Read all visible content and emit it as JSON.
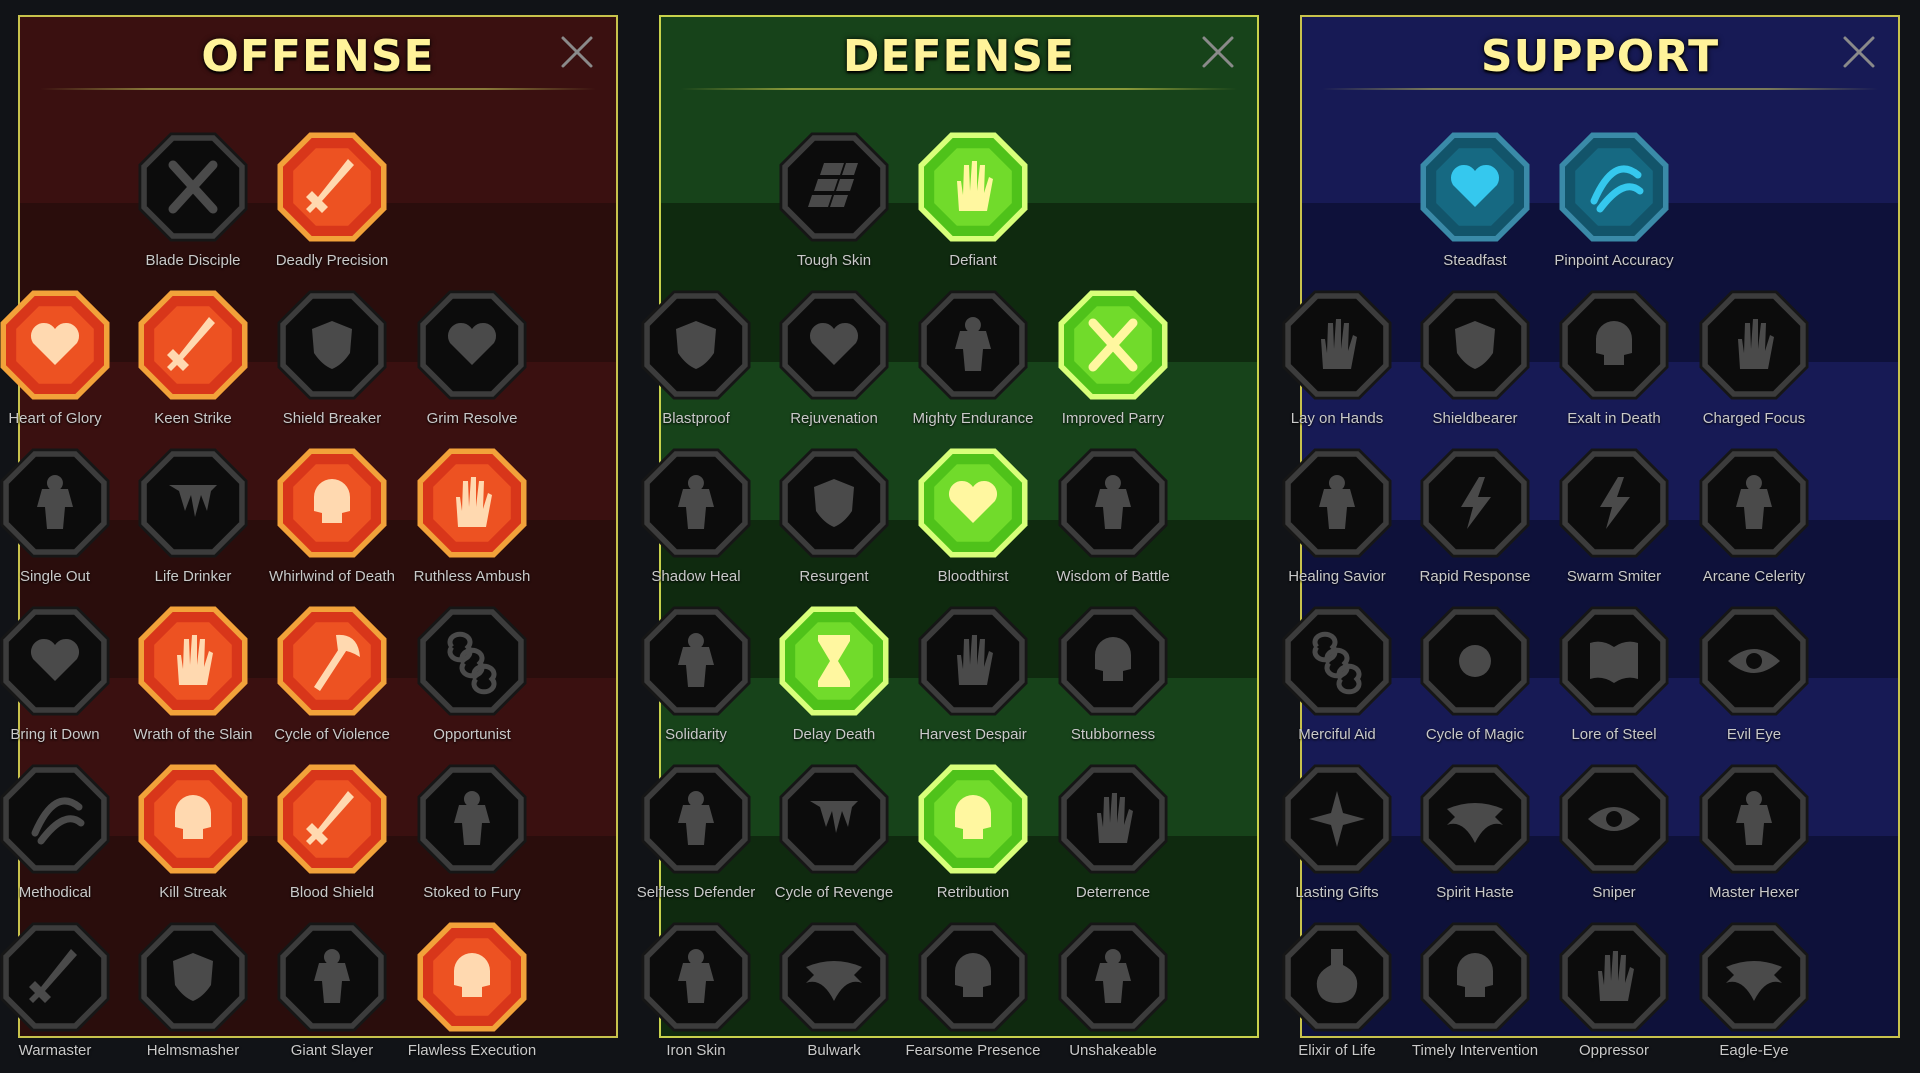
{
  "panels": [
    {
      "key": "offense",
      "title": "OFFENSE",
      "colors": {
        "bg": "#2a0d0c",
        "band": "#3a1010",
        "border": "#c8c24c",
        "rule": "#8a7a3a",
        "ring": "#f2a23a",
        "fill": "#d8361a",
        "inner": "#ff6a2a",
        "glyph": "#ffd9b0"
      },
      "rows": [
        [
          {
            "name": "Blade Disciple",
            "active": false,
            "icon": "crossed-swords-icon"
          },
          {
            "name": "Deadly Precision",
            "active": true,
            "icon": "dagger-slash-icon"
          }
        ],
        [
          {
            "name": "Heart of Glory",
            "active": true,
            "icon": "horned-heart-icon"
          },
          {
            "name": "Keen Strike",
            "active": true,
            "icon": "spear-strike-icon"
          },
          {
            "name": "Shield Breaker",
            "active": false,
            "icon": "broken-shield-icon"
          },
          {
            "name": "Grim Resolve",
            "active": false,
            "icon": "dark-heart-icon"
          }
        ],
        [
          {
            "name": "Single Out",
            "active": false,
            "icon": "arrow-target-icon"
          },
          {
            "name": "Life Drinker",
            "active": false,
            "icon": "fangs-icon"
          },
          {
            "name": "Whirlwind of Death",
            "active": true,
            "icon": "skull-whirl-icon"
          },
          {
            "name": "Ruthless Ambush",
            "active": true,
            "icon": "knife-hand-icon"
          }
        ],
        [
          {
            "name": "Bring it Down",
            "active": false,
            "icon": "heart-sword-icon"
          },
          {
            "name": "Wrath of the Slain",
            "active": true,
            "icon": "fist-blade-icon"
          },
          {
            "name": "Cycle of Violence",
            "active": true,
            "icon": "axe-icon"
          },
          {
            "name": "Opportunist",
            "active": false,
            "icon": "chain-lightning-icon"
          }
        ],
        [
          {
            "name": "Methodical",
            "active": false,
            "icon": "swords-arc-icon"
          },
          {
            "name": "Kill Streak",
            "active": true,
            "icon": "skulls-icon"
          },
          {
            "name": "Blood Shield",
            "active": true,
            "icon": "sword-ring-icon"
          },
          {
            "name": "Stoked to Fury",
            "active": false,
            "icon": "fury-figure-icon"
          }
        ],
        [
          {
            "name": "Warmaster",
            "active": false,
            "icon": "sword-sparkle-icon"
          },
          {
            "name": "Helmsmasher",
            "active": false,
            "icon": "helmet-icon"
          },
          {
            "name": "Giant Slayer",
            "active": false,
            "icon": "giant-icon"
          },
          {
            "name": "Flawless Execution",
            "active": true,
            "icon": "skull-crest-icon"
          }
        ]
      ]
    },
    {
      "key": "defense",
      "title": "DEFENSE",
      "colors": {
        "bg": "#0f2a0f",
        "band": "#17431a",
        "border": "#c8d24c",
        "rule": "#8a9a3a",
        "ring": "#d8ff7a",
        "fill": "#4fc21a",
        "inner": "#8ef03a",
        "glyph": "#fff7a0"
      },
      "rows": [
        [
          {
            "name": "Tough Skin",
            "active": false,
            "icon": "scale-plates-icon"
          },
          {
            "name": "Defiant",
            "active": true,
            "icon": "raised-fist-icon"
          }
        ],
        [
          {
            "name": "Blastproof",
            "active": false,
            "icon": "chevron-shield-icon"
          },
          {
            "name": "Rejuvenation",
            "active": false,
            "icon": "anatomic-heart-icon"
          },
          {
            "name": "Mighty Endurance",
            "active": false,
            "icon": "strongman-icon"
          },
          {
            "name": "Improved Parry",
            "active": true,
            "icon": "crossed-blades-icon"
          }
        ],
        [
          {
            "name": "Shadow Heal",
            "active": false,
            "icon": "shadow-figure-icon"
          },
          {
            "name": "Resurgent",
            "active": false,
            "icon": "knight-shield-icon"
          },
          {
            "name": "Bloodthirst",
            "active": true,
            "icon": "skull-heart-icon"
          },
          {
            "name": "Wisdom of Battle",
            "active": false,
            "icon": "sage-head-icon"
          }
        ],
        [
          {
            "name": "Solidarity",
            "active": false,
            "icon": "crowd-icon"
          },
          {
            "name": "Delay Death",
            "active": true,
            "icon": "hourglass-icon"
          },
          {
            "name": "Harvest Despair",
            "active": false,
            "icon": "open-hand-icon"
          },
          {
            "name": "Stubborness",
            "active": false,
            "icon": "bull-icon"
          }
        ],
        [
          {
            "name": "Selfless Defender",
            "active": false,
            "icon": "dashing-figure-icon"
          },
          {
            "name": "Cycle of Revenge",
            "active": false,
            "icon": "claws-icon"
          },
          {
            "name": "Retribution",
            "active": true,
            "icon": "radiant-skull-icon"
          },
          {
            "name": "Deterrence",
            "active": false,
            "icon": "blocking-hand-icon"
          }
        ],
        [
          {
            "name": "Iron Skin",
            "active": false,
            "icon": "armored-figure-icon"
          },
          {
            "name": "Bulwark",
            "active": false,
            "icon": "winged-shield-icon"
          },
          {
            "name": "Fearsome Presence",
            "active": false,
            "icon": "dread-face-icon"
          },
          {
            "name": "Unshakeable",
            "active": false,
            "icon": "flexing-figure-icon"
          }
        ]
      ]
    },
    {
      "key": "support",
      "title": "SUPPORT",
      "colors": {
        "bg": "#0e113a",
        "band": "#171a55",
        "border": "#c8c24c",
        "rule": "#7a7a5a",
        "ring": "#3a8aa8",
        "fill": "#12546a",
        "inner": "#1a7a96",
        "glyph": "#35c8ee"
      },
      "rows": [
        [
          {
            "name": "Steadfast",
            "active": true,
            "icon": "heart-plus-icon"
          },
          {
            "name": "Pinpoint Accuracy",
            "active": true,
            "icon": "bullseye-icon"
          }
        ],
        [
          {
            "name": "Lay on Hands",
            "active": false,
            "icon": "praying-hands-icon"
          },
          {
            "name": "Shieldbearer",
            "active": false,
            "icon": "ringed-shield-icon"
          },
          {
            "name": "Exalt in Death",
            "active": false,
            "icon": "flaming-skull-icon"
          },
          {
            "name": "Charged Focus",
            "active": false,
            "icon": "swift-hand-icon"
          }
        ],
        [
          {
            "name": "Healing Savior",
            "active": false,
            "icon": "healer-figure-icon"
          },
          {
            "name": "Rapid Response",
            "active": false,
            "icon": "lightning-icon"
          },
          {
            "name": "Swarm Smiter",
            "active": false,
            "icon": "zigzag-icon"
          },
          {
            "name": "Arcane Celerity",
            "active": false,
            "icon": "afterimage-icon"
          }
        ],
        [
          {
            "name": "Merciful Aid",
            "active": false,
            "icon": "chained-heart-icon"
          },
          {
            "name": "Cycle of Magic",
            "active": false,
            "icon": "comet-icon"
          },
          {
            "name": "Lore of Steel",
            "active": false,
            "icon": "open-book-icon"
          },
          {
            "name": "Evil Eye",
            "active": false,
            "icon": "glaring-eyes-icon"
          }
        ],
        [
          {
            "name": "Lasting Gifts",
            "active": false,
            "icon": "compass-star-icon"
          },
          {
            "name": "Spirit Haste",
            "active": false,
            "icon": "winged-boot-icon"
          },
          {
            "name": "Sniper",
            "active": false,
            "icon": "eye-icon"
          },
          {
            "name": "Master Hexer",
            "active": false,
            "icon": "voodoo-doll-icon"
          }
        ],
        [
          {
            "name": "Elixir of Life",
            "active": false,
            "icon": "potion-icon"
          },
          {
            "name": "Timely Intervention",
            "active": false,
            "icon": "winged-skull-icon"
          },
          {
            "name": "Oppressor",
            "active": false,
            "icon": "grasping-hand-icon"
          },
          {
            "name": "Eagle-Eye",
            "active": false,
            "icon": "eagle-icon"
          }
        ]
      ]
    }
  ]
}
